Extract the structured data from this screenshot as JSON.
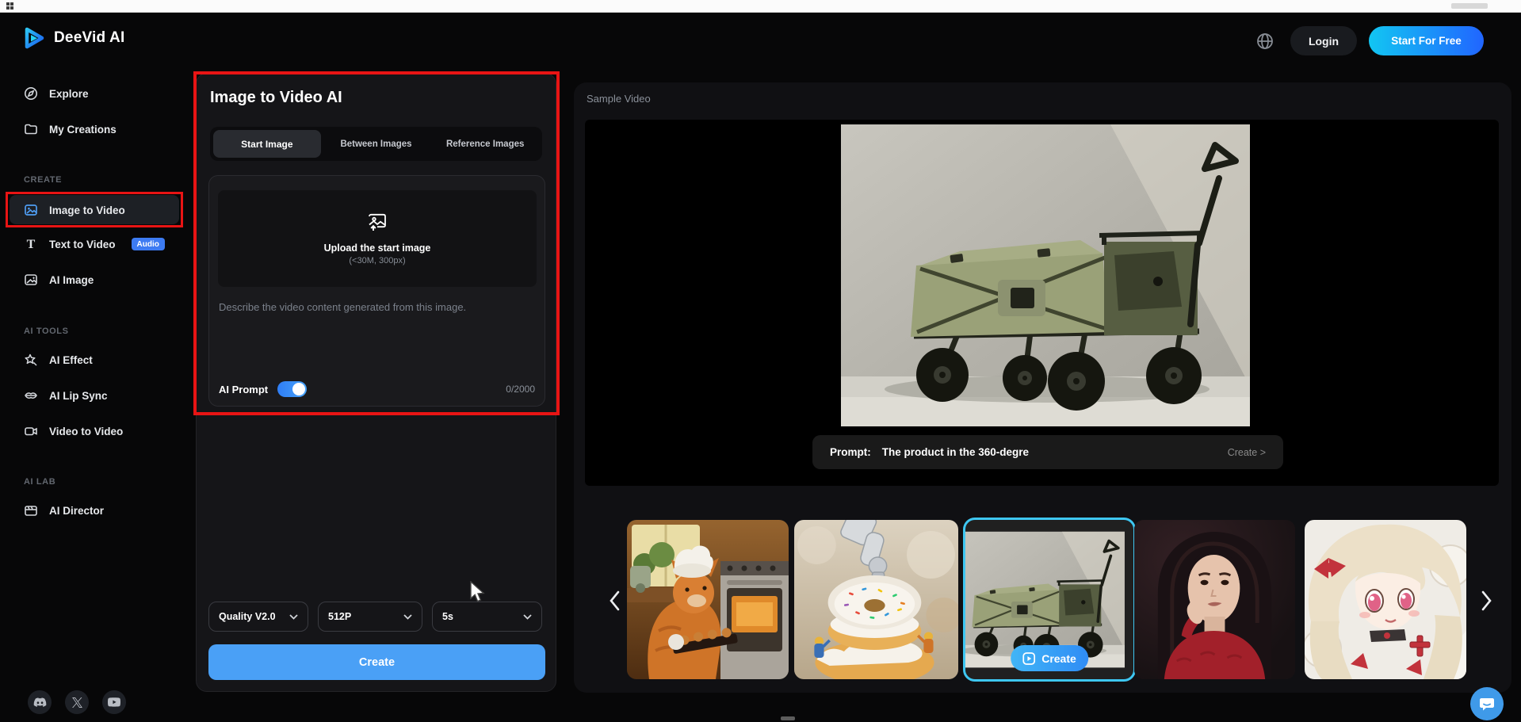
{
  "header": {
    "brand": "DeeVid AI",
    "login": "Login",
    "start_for_free": "Start For Free"
  },
  "sidebar": {
    "explore": "Explore",
    "my_creations": "My Creations",
    "create_section": "CREATE",
    "image_to_video": "Image to Video",
    "text_to_video": "Text to Video",
    "audio_badge": "Audio",
    "ai_image": "AI Image",
    "ai_tools_section": "AI TOOLS",
    "ai_effect": "AI Effect",
    "ai_lip_sync": "AI Lip Sync",
    "video_to_video": "Video to Video",
    "ai_lab_section": "AI LAB",
    "ai_director": "AI Director"
  },
  "composer": {
    "title": "Image to Video AI",
    "tab_start_image": "Start Image",
    "tab_between_images": "Between Images",
    "tab_reference_images": "Reference Images",
    "upload_title": "Upload the start image",
    "upload_subtitle": "(<30M, 300px)",
    "prompt_placeholder": "Describe the video content generated from this image.",
    "prompt_value": "",
    "ai_prompt_label": "AI Prompt",
    "ai_prompt_on": true,
    "char_counter": "0/2000",
    "select_quality": "Quality V2.0",
    "select_resolution": "512P",
    "select_duration": "5s",
    "create_label": "Create"
  },
  "preview": {
    "title": "Sample Video",
    "prompt_label": "Prompt:",
    "prompt_text": "The product in the 360-degre",
    "create_link": "Create >",
    "thumb_create_label": "Create",
    "thumbs": [
      {
        "name": "cat-chef-baking"
      },
      {
        "name": "robot-arm-donuts"
      },
      {
        "name": "folding-wagon",
        "selected": true
      },
      {
        "name": "woman-red-sweater"
      },
      {
        "name": "anime-girl-red-ribbons"
      }
    ]
  },
  "icons": {
    "logo": "play-triangle",
    "language": "globe",
    "explore": "compass",
    "my_creations": "folder",
    "image_to_video": "image-frame",
    "text_to_video": "letter-T",
    "ai_image": "image-sparkle",
    "ai_effect": "star-wand",
    "ai_lip_sync": "lips",
    "video_to_video": "video-camera",
    "ai_director": "clapperboard",
    "upload": "image-upload-arrow",
    "select_chevron": "chevron-down",
    "carousel_prev": "chevron-left",
    "carousel_next": "chevron-right",
    "social": [
      "discord",
      "x-twitter",
      "youtube"
    ],
    "chat": "chat-bubble-smile",
    "thumb_play": "play-rounded-square"
  },
  "colors": {
    "page_bg": "#070708",
    "panel_bg": "#151518",
    "accent_blue": "#2f8df5",
    "create_button": "#4aa0f6",
    "toggle_on": "#3b82f6",
    "cta_gradient_start": "#12c6f2",
    "cta_gradient_end": "#2165ff",
    "selected_border": "#3ec7f2",
    "annotation_red": "#e81414",
    "audio_badge": "#3d7bf2"
  }
}
